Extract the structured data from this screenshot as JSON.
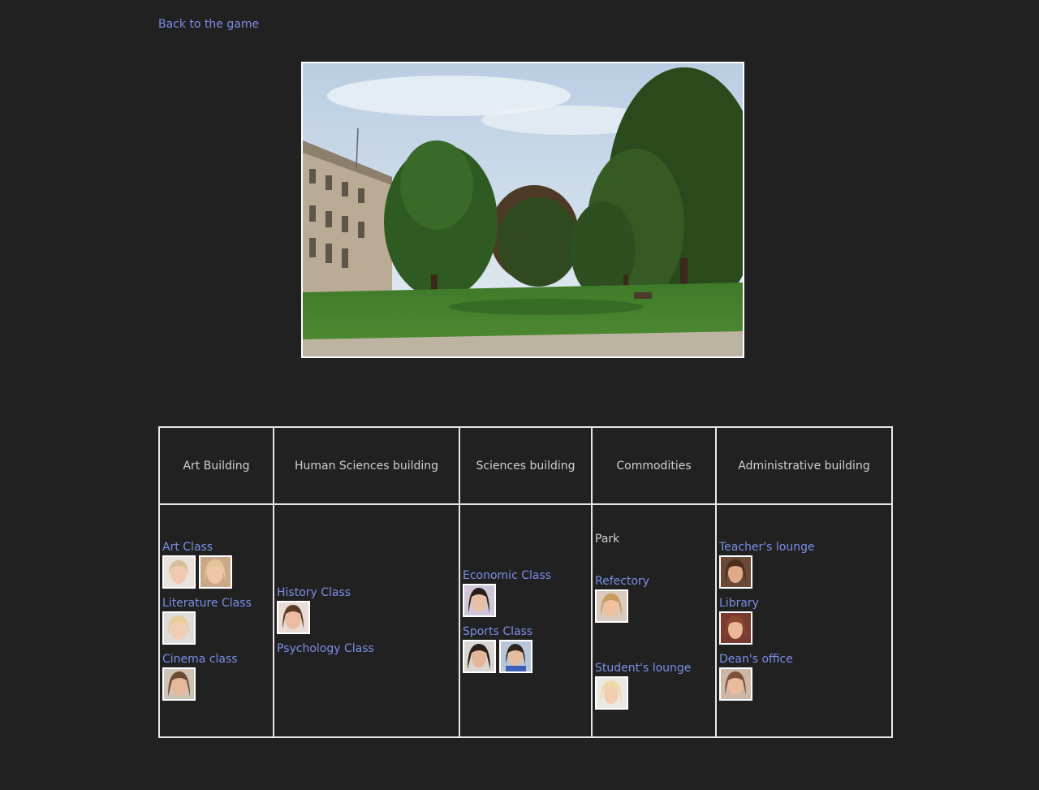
{
  "nav": {
    "back_label": "Back to the game"
  },
  "table": {
    "headers": [
      "Art Building",
      "Human Sciences building",
      "Sciences building",
      "Commodities",
      "Administrative building"
    ],
    "art": {
      "rooms": [
        "Art Class",
        "Literature Class",
        "Cinema class"
      ]
    },
    "human": {
      "rooms": [
        "History Class",
        "Psychology Class"
      ]
    },
    "sciences": {
      "rooms": [
        "Economic Class",
        "Sports Class"
      ]
    },
    "commodities": {
      "rooms": [
        "Park",
        "Refectory",
        "Student's lounge"
      ]
    },
    "admin": {
      "rooms": [
        "Teacher's lounge",
        "Library",
        "Dean's office"
      ]
    }
  },
  "colors": {
    "background": "#212121",
    "link": "#7b8fe6",
    "text": "#cfcfcf",
    "border": "#e6e6e6"
  }
}
